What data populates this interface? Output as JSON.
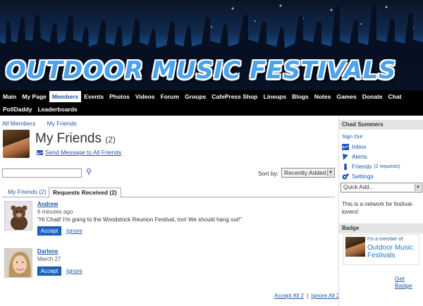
{
  "banner": {
    "title": "Outdoor Music Festivals"
  },
  "nav": {
    "row1": [
      "Main",
      "My Page",
      "Members",
      "Events",
      "Photos",
      "Videos",
      "Forum",
      "Groups",
      "CafePress Shop",
      "Lineups",
      "Blogs",
      "Notes",
      "Games",
      "Donate",
      "Chat"
    ],
    "row2": [
      "PollDaddy",
      "Leaderboards"
    ],
    "active": "Members"
  },
  "breadcrumb": {
    "all_members": "All Members",
    "my_friends": "My Friends"
  },
  "page": {
    "title": "My Friends",
    "count": "(2)",
    "send_message": "Send Message to All Friends"
  },
  "search": {
    "value": "",
    "placeholder": ""
  },
  "sort": {
    "label": "Sort by:",
    "selected": "Recently Added"
  },
  "tabs": {
    "my_friends": "My Friends (2)",
    "requests_received": "Requests Received (2)"
  },
  "requests": [
    {
      "name": "Andrew",
      "time": "6 minutes ago",
      "message": "\"Hi Chad! I'm going to the Woodstock Reunion Festival, too! We should hang out!\"",
      "accept": "Accept",
      "ignore": "Ignore"
    },
    {
      "name": "Darlene",
      "time": "March 27",
      "message": "",
      "accept": "Accept",
      "ignore": "Ignore"
    }
  ],
  "bulk": {
    "accept_all": "Accept All 2",
    "separator": "|",
    "ignore_all": "Ignore All 2"
  },
  "sidebar": {
    "user_name": "Chad Summers",
    "sign_out": "Sign Out",
    "inbox": "Inbox",
    "alerts": "Alerts",
    "friends": "Friends",
    "friends_requests": "(2 requests)",
    "settings": "Settings",
    "quick_add": "Quick Add...",
    "network_desc": "This is a network for festival-lovers!",
    "badge_heading": "Badge",
    "badge_line1": "I'm a member of",
    "badge_line2": "Outdoor Music Festivals",
    "get_badge": "Get Badge"
  },
  "colors": {
    "link": "#1f57a8",
    "accept_button": "#1a66c6",
    "nav_bg": "#000000"
  }
}
